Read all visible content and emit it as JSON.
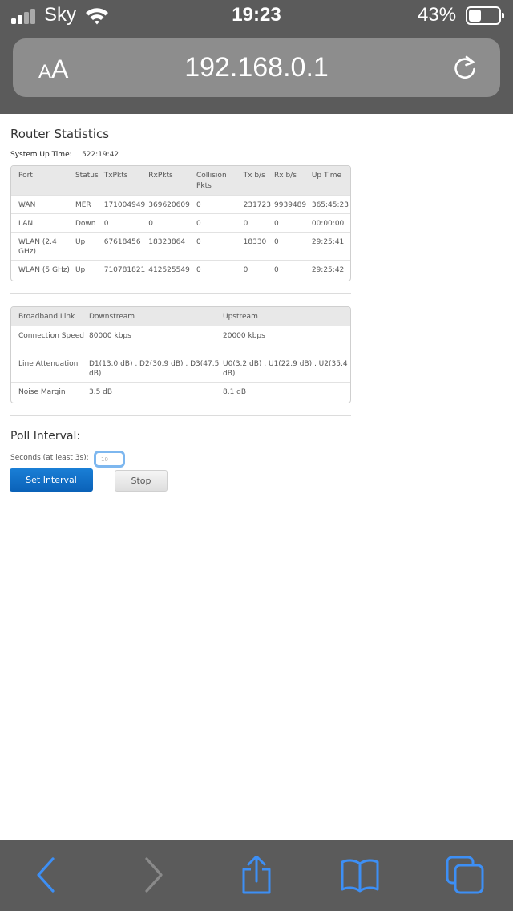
{
  "status_bar": {
    "carrier": "Sky",
    "time": "19:23",
    "battery_percent": "43%",
    "battery_level": 0.43
  },
  "url_bar": {
    "reader_small": "A",
    "reader_big": "A",
    "url": "192.168.0.1"
  },
  "page": {
    "title": "Router Statistics",
    "uptime_label": "System Up Time:",
    "uptime_value": "522:19:42",
    "stats": {
      "headers": [
        "Port",
        "Status",
        "TxPkts",
        "RxPkts",
        "Collision Pkts",
        "Tx b/s",
        "Rx b/s",
        "Up Time"
      ],
      "rows": [
        [
          "WAN",
          "MER",
          "171004949",
          "369620609",
          "0",
          "231723",
          "9939489",
          "365:45:23"
        ],
        [
          "LAN",
          "Down",
          "0",
          "0",
          "0",
          "0",
          "0",
          "00:00:00"
        ],
        [
          "WLAN (2.4 GHz)",
          "Up",
          "67618456",
          "18323864",
          "0",
          "18330",
          "0",
          "29:25:41"
        ],
        [
          "WLAN (5 GHz)",
          "Up",
          "710781821",
          "412525549",
          "0",
          "0",
          "0",
          "29:25:42"
        ]
      ]
    },
    "broadband": {
      "headers": [
        "Broadband Link",
        "Downstream",
        "Upstream"
      ],
      "rows": [
        [
          "Connection Speed",
          "80000 kbps",
          "20000 kbps"
        ],
        [
          "Line Attenuation",
          "D1(13.0 dB) , D2(30.9 dB) , D3(47.5 dB)",
          "U0(3.2 dB) , U1(22.9 dB) , U2(35.4 dB)"
        ],
        [
          "Noise Margin",
          "3.5 dB",
          "8.1 dB"
        ]
      ]
    },
    "poll": {
      "title": "Poll Interval:",
      "seconds_label": "Seconds (at least 3s):",
      "seconds_value": "10",
      "set_button": "Set Interval",
      "stop_button": "Stop"
    }
  },
  "colors": {
    "chrome": "#5b5b5b",
    "url_bar": "#8d8d8d",
    "toolbar_active": "#3d8ff5",
    "toolbar_disabled": "#8a8a8a",
    "primary_button": "#0a6cc9"
  },
  "toolbar": {
    "icons": [
      "back-icon",
      "forward-icon",
      "share-icon",
      "bookmarks-icon",
      "tabs-icon"
    ]
  }
}
